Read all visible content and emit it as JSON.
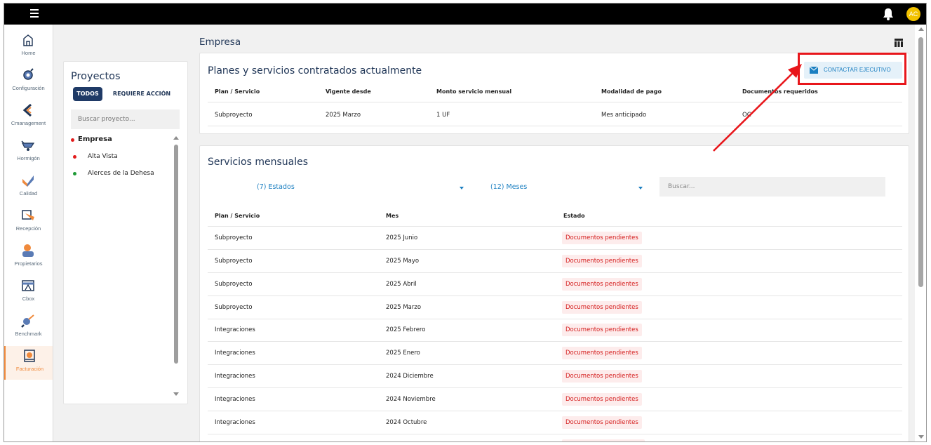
{
  "topbar": {
    "avatar_initials": "AC"
  },
  "sidenav": {
    "items": [
      {
        "label": "Home",
        "icon": "home-icon"
      },
      {
        "label": "Configuración",
        "icon": "gear-icon"
      },
      {
        "label": "Cmanagement",
        "icon": "cmanagement-icon"
      },
      {
        "label": "Hormigón",
        "icon": "wheelbarrow-icon"
      },
      {
        "label": "Calidad",
        "icon": "check-icon"
      },
      {
        "label": "Recepción",
        "icon": "reception-icon"
      },
      {
        "label": "Propietarios",
        "icon": "owner-icon"
      },
      {
        "label": "Cbox",
        "icon": "cbox-icon"
      },
      {
        "label": "Benchmark",
        "icon": "benchmark-icon"
      },
      {
        "label": "Facturación",
        "icon": "billing-icon",
        "active": true
      }
    ]
  },
  "projects": {
    "title": "Proyectos",
    "tab_all": "TODOS",
    "tab_action": "REQUIERE ACCIÓN",
    "search_placeholder": "Buscar proyecto...",
    "items": [
      {
        "name": "Empresa",
        "color": "#e21b1b"
      },
      {
        "name": "Alta Vista",
        "color": "#e21b1b"
      },
      {
        "name": "Alerces de la Dehesa",
        "color": "#1f9a36"
      }
    ]
  },
  "page": {
    "title": "Empresa"
  },
  "plans": {
    "title": "Planes y servicios contratados actualmente",
    "contact_button": "CONTACTAR EJECUTIVO",
    "columns": [
      "Plan / Servicio",
      "Vigente desde",
      "Monto servicio mensual",
      "Modalidad de pago",
      "Documentos requeridos"
    ],
    "rows": [
      [
        "Subproyecto",
        "2025 Marzo",
        "1 UF",
        "Mes anticipado",
        "OC"
      ]
    ]
  },
  "monthly": {
    "title": "Servicios mensuales",
    "filter_states": "(7) Estados",
    "filter_months": "(12) Meses",
    "search_placeholder": "Buscar...",
    "columns": [
      "Plan / Servicio",
      "Mes",
      "Estado"
    ],
    "rows": [
      [
        "Subproyecto",
        "2025 Junio",
        "Documentos pendientes"
      ],
      [
        "Subproyecto",
        "2025 Mayo",
        "Documentos pendientes"
      ],
      [
        "Subproyecto",
        "2025 Abril",
        "Documentos pendientes"
      ],
      [
        "Subproyecto",
        "2025 Marzo",
        "Documentos pendientes"
      ],
      [
        "Integraciones",
        "2025 Febrero",
        "Documentos pendientes"
      ],
      [
        "Integraciones",
        "2025 Enero",
        "Documentos pendientes"
      ],
      [
        "Integraciones",
        "2024 Diciembre",
        "Documentos pendientes"
      ],
      [
        "Integraciones",
        "2024 Noviembre",
        "Documentos pendientes"
      ],
      [
        "Integraciones",
        "2024 Octubre",
        "Documentos pendientes"
      ]
    ]
  },
  "colors": {
    "highlight": "#e8161b",
    "accent": "#1b7fc1",
    "active_nav": "#f08a3c",
    "badge_text": "#d41b1b"
  }
}
